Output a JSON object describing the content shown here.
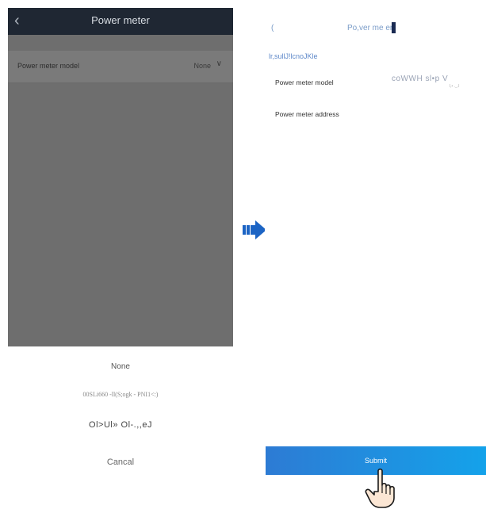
{
  "left_screen": {
    "back_icon": "chevron-left-icon",
    "title": "Power meter",
    "model_row": {
      "label": "Power meter model",
      "value": "None",
      "chevron_icon": "chevron-down-icon"
    },
    "options": [
      "None",
      "00SLi660 -ll(S;ogk - PNI1<:)",
      "Ol>Ul» Ol-.,,eJ"
    ],
    "cancel_label": "Cancal",
    "overlay_color": "#6e6e6e",
    "header_color": "#1f2733"
  },
  "arrow_icon": "arrow-right-icon",
  "right_screen": {
    "header_left": "(",
    "header_title": "Po,ver  me   er",
    "subtitle": "lr,sullJ!lcnoJKle",
    "model_label": "Power meter model",
    "model_value": "coWWH sl•p V",
    "model_value_sub": "l,• ._.l",
    "address_label": "Power meter address",
    "submit_label": "Submit",
    "hand_icon": "pointer-hand-icon",
    "accent_color": "#1a8fe0"
  }
}
